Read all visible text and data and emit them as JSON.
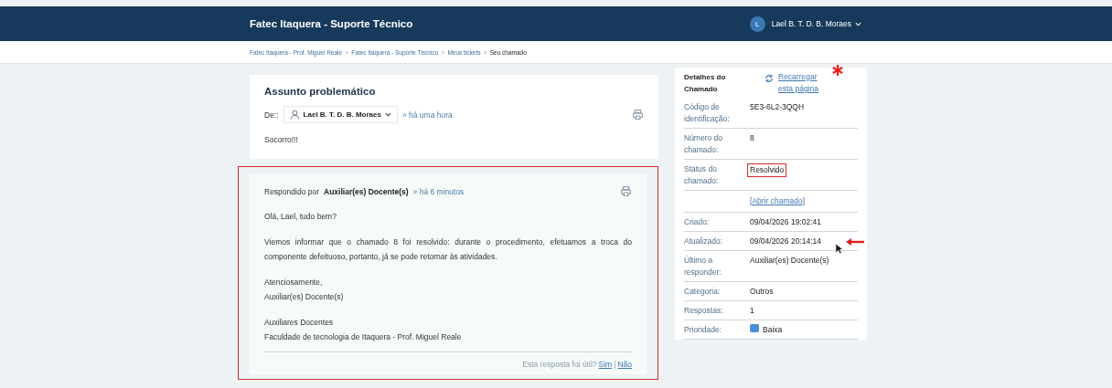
{
  "header": {
    "title": "Fatec Itaquera - Suporte Técnico",
    "user": {
      "initial": "L",
      "name": "Lael B. T. D. B. Moraes"
    }
  },
  "breadcrumb_separator": "›",
  "breadcrumb": [
    {
      "label": "Fatec Itaquera - Prof. Miguel Reale",
      "current": false
    },
    {
      "label": "Fatec Itaquera - Suporte Técnico",
      "current": false
    },
    {
      "label": "Meus tickets",
      "current": false
    },
    {
      "label": "Seu chamado",
      "current": true
    }
  ],
  "ticket": {
    "subject": "Assunto problemático",
    "from_label": "De::",
    "from_user": "Lael B. T. D. B. Moraes",
    "time": "» há uma hora",
    "body": "Socorro!!!"
  },
  "reply": {
    "by_label": "Respondido por",
    "by": "Auxiliar(es) Docente(s)",
    "time": "» há 6 minutos",
    "highlighted": true,
    "paragraphs": [
      [
        "Olá, Lael, tudo bem?"
      ],
      [
        "Viemos informar que o chamado 8 foi resolvido: durante o procedimento, efetuamos a troca do componente defeituoso, portanto, já se pode retornar às atividades."
      ],
      [
        "Atenciosamente,",
        "Auxiliar(es) Docente(s)"
      ],
      [
        "Auxiliares Docentes",
        "Faculdade de tecnologia de Itaquera - Prof. Miguel Reale"
      ]
    ],
    "feedback_question": "Esta resposta foi útil?",
    "feedback_yes": "Sim",
    "feedback_separator": "|",
    "feedback_no": "Não"
  },
  "details": {
    "title": "Detalhes do Chamado",
    "reload": "Recarregar esta página",
    "reload_marked": true,
    "rows": [
      {
        "kind": "field",
        "label": "Código de identificação:",
        "value": "5E3-6L2-3QQH",
        "highlighted": false,
        "pointed": false
      },
      {
        "kind": "field",
        "label": "Número do chamado:",
        "value": "8",
        "highlighted": false,
        "pointed": false
      },
      {
        "kind": "field",
        "label": "Status do chamado:",
        "value": "Resolvido",
        "highlighted": true,
        "pointed": false
      },
      {
        "kind": "link",
        "open": "[",
        "value": "Abrir chamado",
        "close": "]"
      },
      {
        "kind": "field",
        "label": "Criado:",
        "value": "09/04/2026 19:02:41",
        "highlighted": false,
        "pointed": false
      },
      {
        "kind": "field",
        "label": "Atualizado:",
        "value": "09/04/2026 20:14:14",
        "highlighted": false,
        "pointed": true
      },
      {
        "kind": "field",
        "label": "Último a responder:",
        "value": "Auxiliar(es) Docente(s)",
        "highlighted": false,
        "pointed": false
      },
      {
        "kind": "field",
        "label": "Categoria:",
        "value": "Outros",
        "highlighted": false,
        "pointed": false
      },
      {
        "kind": "field",
        "label": "Respostas:",
        "value": "1",
        "highlighted": false,
        "pointed": false
      },
      {
        "kind": "priority",
        "label": "Prioridade:",
        "value": "Baixa",
        "color": "#4a90d9"
      }
    ]
  }
}
